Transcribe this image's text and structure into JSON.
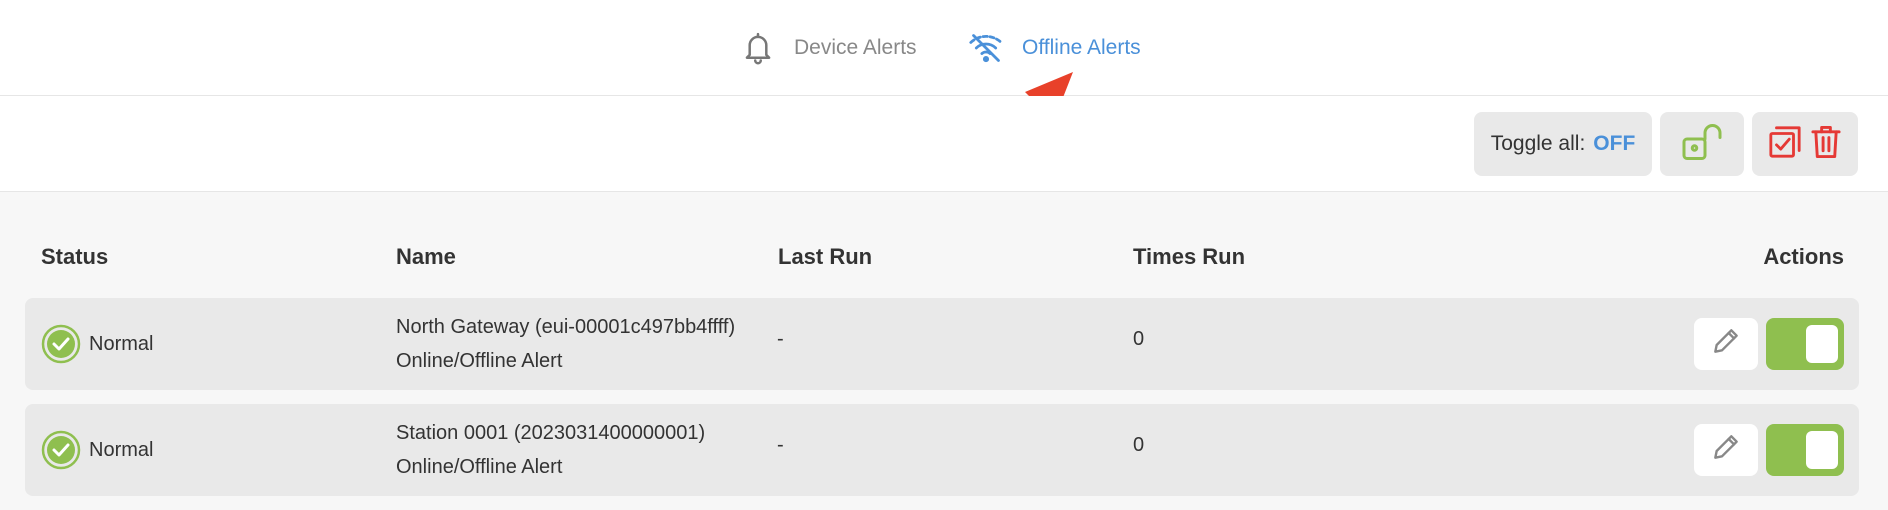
{
  "tabs": [
    {
      "label": "Device Alerts",
      "icon": "bell-icon",
      "active": false
    },
    {
      "label": "Offline Alerts",
      "icon": "wifi-off-icon",
      "active": true
    }
  ],
  "toolbar": {
    "toggle_all_label": "Toggle all:",
    "toggle_all_value": "OFF",
    "lock_icon": "unlock-icon",
    "bulk_icons": [
      "checklist-icon",
      "trash-icon"
    ]
  },
  "table": {
    "headers": {
      "status": "Status",
      "name": "Name",
      "last_run": "Last Run",
      "times_run": "Times Run",
      "actions": "Actions"
    },
    "rows": [
      {
        "status": "Normal",
        "name": "North Gateway (eui-00001c497bb4ffff) Online/Offline Alert",
        "last_run": "-",
        "times_run": "0",
        "enabled": true
      },
      {
        "status": "Normal",
        "name": "Station 0001 (2023031400000001) Online/Offline Alert",
        "last_run": "-",
        "times_run": "0",
        "enabled": true
      }
    ]
  },
  "colors": {
    "accent_blue": "#4a90d9",
    "success_green": "#8fbf4f",
    "danger_red": "#e53935",
    "annotation_arrow": "#e8412a"
  }
}
